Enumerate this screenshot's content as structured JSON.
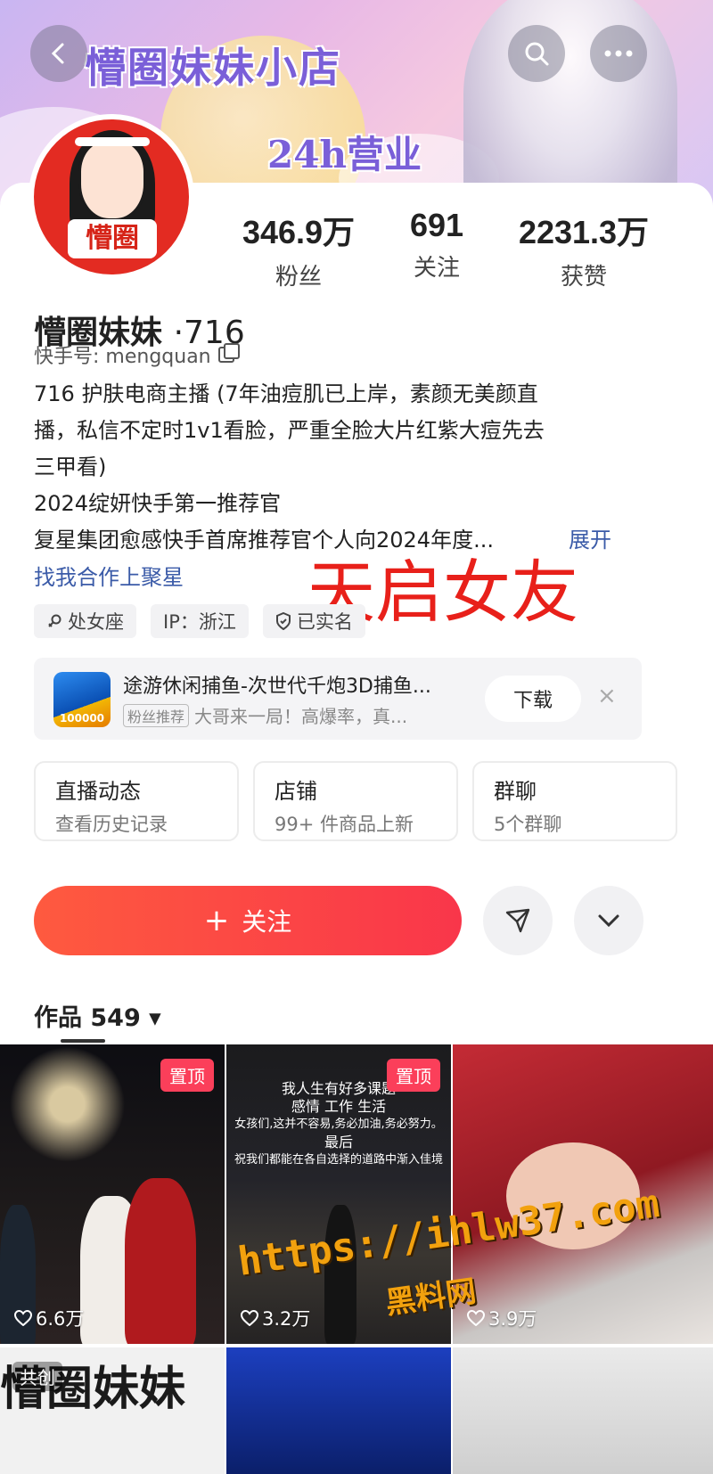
{
  "banner": {
    "title": "懵圈妹妹小店",
    "subtitle": "24h营业"
  },
  "avatar": {
    "label": "懵圈"
  },
  "stats": [
    {
      "value": "346.9万",
      "label": "粉丝"
    },
    {
      "value": "691",
      "label": "关注"
    },
    {
      "value": "2231.3万",
      "label": "获赞"
    }
  ],
  "profile": {
    "name": "懵圈妹妹",
    "name_suffix": "·716",
    "kuaishou_id": "快手号: mengquan",
    "bio_lines": [
      "716 护肤电商主播 (7年油痘肌已上岸，素颜无美颜直",
      "播，私信不定时1v1看脸，严重全脸大片红紫大痘先去",
      "三甲看)",
      "2024绽妍快手第一推荐官",
      "复星集团愈感快手首席推荐官个人向2024年度..."
    ],
    "expand": "展开",
    "cooperate": "找我合作上聚星",
    "overlay_text": "天启女友"
  },
  "tags": [
    {
      "icon": "female-icon",
      "label": "处女座"
    },
    {
      "icon": "",
      "label": "IP：浙江"
    },
    {
      "icon": "shield-check-icon",
      "label": "已实名"
    }
  ],
  "ad": {
    "icon_text": "100000",
    "title": "途游休闲捕鱼-次世代千炮3D捕鱼...",
    "badge": "粉丝推荐",
    "subtitle": "大哥来一局！高爆率，真...",
    "download": "下载",
    "close": "×"
  },
  "entries": [
    {
      "title": "直播动态",
      "sub": "查看历史记录"
    },
    {
      "title": "店铺",
      "sub": "99+ 件商品上新"
    },
    {
      "title": "群聊",
      "sub": "5个群聊"
    }
  ],
  "actions": {
    "follow": "关注",
    "follow_plus": "+"
  },
  "works": {
    "label": "作品 549",
    "arrow": "▾"
  },
  "grid": [
    {
      "pinned": "置顶",
      "likes": "6.6万"
    },
    {
      "pinned": "置顶",
      "likes": "3.2万",
      "text_lines": [
        "我人生有好多课题",
        "感情 工作 生活",
        "女孩们,这并不容易,务必加油,务必努力。",
        "最后",
        "祝我们都能在各自选择的道路中渐入佳境"
      ]
    },
    {
      "pinned": "",
      "likes": "3.9万"
    }
  ],
  "watermark": {
    "url": "https://ihlw37.com",
    "name": "黑料网"
  },
  "bottom_row": {
    "badge": "共创",
    "title": "懵圈妹妹"
  },
  "colors": {
    "accent": "#f9364a",
    "link": "#3b5ba8",
    "pin": "#fb3f5a"
  }
}
